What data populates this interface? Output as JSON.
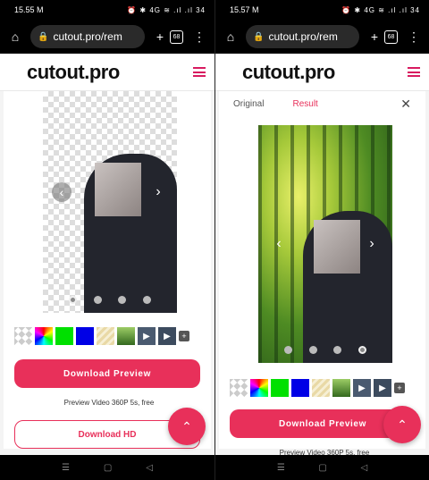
{
  "left": {
    "status": {
      "time": "15.55",
      "extra": "M",
      "icons": "⏰ ✱ 4G ≋ .ıl .ıl",
      "battery": "34"
    },
    "browser": {
      "url": "cutout.pro/rem",
      "tab_count": "68"
    },
    "site": {
      "logo": "cutout.pro"
    },
    "buttons": {
      "download_preview": "Download Preview",
      "preview_note": "Preview Video 360P 5s, free",
      "download_hd": "Download HD"
    }
  },
  "right": {
    "status": {
      "time": "15.57",
      "extra": "M",
      "icons": "⏰ ✱ 4G ≋ .ıl .ıl",
      "battery": "34"
    },
    "browser": {
      "url": "cutout.pro/rem",
      "tab_count": "68"
    },
    "site": {
      "logo": "cutout.pro"
    },
    "tabs": {
      "original": "Original",
      "result": "Result"
    },
    "buttons": {
      "download_preview": "Download Preview",
      "preview_note": "Preview Video 360P 5s, free"
    }
  },
  "icons": {
    "home": "⌂",
    "lock": "🔒",
    "plus": "+",
    "menu": "⋮",
    "prev": "‹",
    "next": "›",
    "up": "⌃",
    "close": "✕",
    "play": "▶",
    "add": "+",
    "nav_recent": "☰",
    "nav_home": "▢",
    "nav_back": "◁"
  },
  "colors": {
    "accent": "#e8305a",
    "brand_menu": "#d81b60"
  }
}
